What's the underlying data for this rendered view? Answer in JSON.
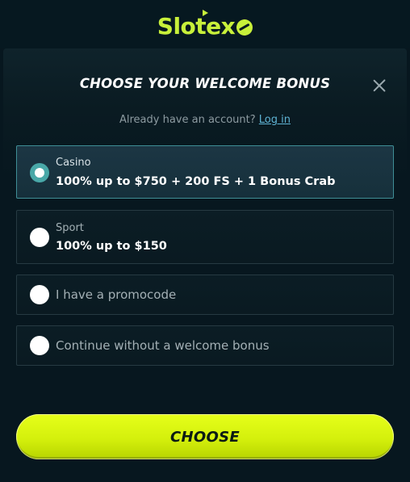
{
  "brand": {
    "logo_text": "Slotex"
  },
  "modal": {
    "title": "CHOOSE YOUR WELCOME BONUS",
    "login_prompt": "Already have an account?",
    "login_link": "Log in",
    "options": [
      {
        "category": "Casino",
        "offer": "100% up to $750 + 200 FS + 1 Bonus Crab",
        "selected": true
      },
      {
        "category": "Sport",
        "offer": "100% up to $150",
        "selected": false
      },
      {
        "label": "I have a promocode",
        "selected": false
      },
      {
        "label": "Continue without a welcome bonus",
        "selected": false
      }
    ],
    "choose_button": "CHOOSE"
  },
  "colors": {
    "accent": "#d8f20f",
    "selected_radio": "#49a8a8",
    "selected_border": "#3f8e96",
    "link": "#5fb3d4",
    "background": "#07171f"
  },
  "icons": [
    "close-icon",
    "radio-checked-icon",
    "radio-unchecked-icon"
  ]
}
